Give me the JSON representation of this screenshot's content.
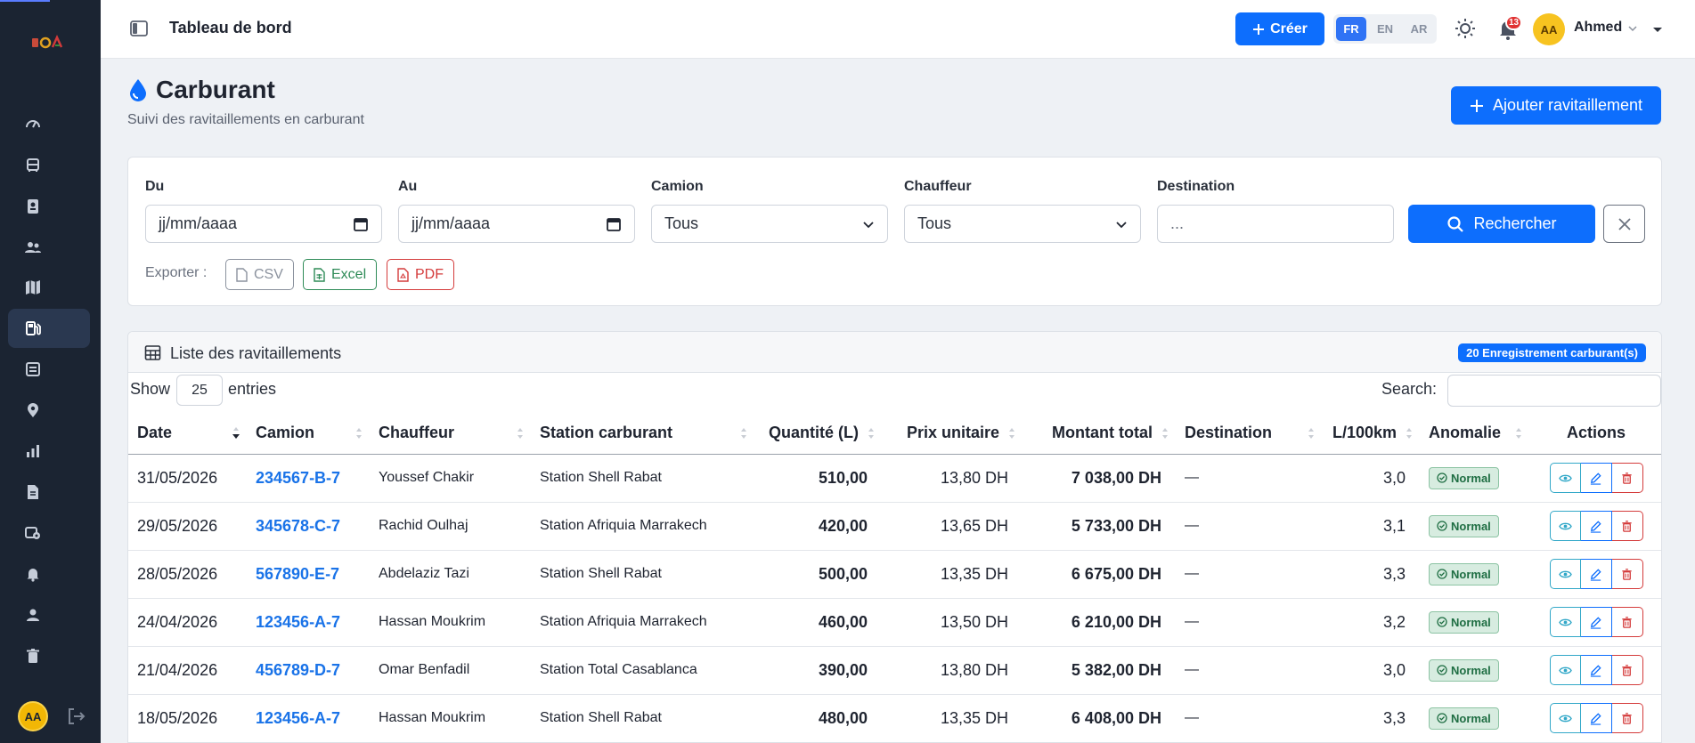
{
  "topbar": {
    "title": "Tableau de bord",
    "create_label": "Créer",
    "languages": [
      "FR",
      "EN",
      "AR"
    ],
    "active_language": "FR",
    "notification_count": "13",
    "user_initials": "AA",
    "user_name": "Ahmed"
  },
  "sidebar": {
    "items": [
      {
        "icon": "gauge-icon",
        "active": false
      },
      {
        "icon": "bus-icon",
        "active": false
      },
      {
        "icon": "id-card-icon",
        "active": false
      },
      {
        "icon": "users-icon",
        "active": false
      },
      {
        "icon": "map-icon",
        "active": false
      },
      {
        "icon": "fuel-pump-icon",
        "active": true
      },
      {
        "icon": "receipt-icon",
        "active": false
      },
      {
        "icon": "map-pin-icon",
        "active": false
      },
      {
        "icon": "bar-chart-icon",
        "active": false
      },
      {
        "icon": "document-icon",
        "active": false
      },
      {
        "icon": "settings-icon",
        "active": false
      },
      {
        "icon": "bell-icon",
        "active": false
      },
      {
        "icon": "user-icon",
        "active": false
      },
      {
        "icon": "trash-icon",
        "active": false
      }
    ],
    "user_initials": "AA"
  },
  "page": {
    "title": "Carburant",
    "subtitle": "Suivi des ravitaillements en carburant",
    "add_label": "Ajouter ravitaillement"
  },
  "filters": {
    "from_label": "Du",
    "from_placeholder": "jj/mm/aaaa",
    "to_label": "Au",
    "to_placeholder": "jj/mm/aaaa",
    "truck_label": "Camion",
    "truck_value": "Tous",
    "driver_label": "Chauffeur",
    "driver_value": "Tous",
    "destination_label": "Destination",
    "destination_placeholder": "...",
    "search_label": "Rechercher",
    "export_label": "Exporter :",
    "export_csv": "CSV",
    "export_excel": "Excel",
    "export_pdf": "PDF"
  },
  "table": {
    "card_title": "Liste des ravitaillements",
    "count_badge": "20 Enregistrement carburant(s)",
    "show_label": "Show",
    "show_value": "25",
    "entries_label": "entries",
    "search_label": "Search:",
    "columns": [
      "Date",
      "Camion",
      "Chauffeur",
      "Station carburant",
      "Quantité (L)",
      "Prix unitaire",
      "Montant total",
      "Destination",
      "L/100km",
      "Anomalie",
      "Actions"
    ],
    "rows": [
      {
        "date": "31/05/2026",
        "truck": "234567-B-7",
        "driver": "Youssef Chakir",
        "station": "Station Shell Rabat",
        "qty": "510,00",
        "price": "13,80 DH",
        "total": "7 038,00 DH",
        "dest": "—",
        "l100": "3,0",
        "anomaly": "Normal"
      },
      {
        "date": "29/05/2026",
        "truck": "345678-C-7",
        "driver": "Rachid Oulhaj",
        "station": "Station Afriquia Marrakech",
        "qty": "420,00",
        "price": "13,65 DH",
        "total": "5 733,00 DH",
        "dest": "—",
        "l100": "3,1",
        "anomaly": "Normal"
      },
      {
        "date": "28/05/2026",
        "truck": "567890-E-7",
        "driver": "Abdelaziz Tazi",
        "station": "Station Shell Rabat",
        "qty": "500,00",
        "price": "13,35 DH",
        "total": "6 675,00 DH",
        "dest": "—",
        "l100": "3,3",
        "anomaly": "Normal"
      },
      {
        "date": "24/04/2026",
        "truck": "123456-A-7",
        "driver": "Hassan Moukrim",
        "station": "Station Afriquia Marrakech",
        "qty": "460,00",
        "price": "13,50 DH",
        "total": "6 210,00 DH",
        "dest": "—",
        "l100": "3,2",
        "anomaly": "Normal"
      },
      {
        "date": "21/04/2026",
        "truck": "456789-D-7",
        "driver": "Omar Benfadil",
        "station": "Station Total Casablanca",
        "qty": "390,00",
        "price": "13,80 DH",
        "total": "5 382,00 DH",
        "dest": "—",
        "l100": "3,0",
        "anomaly": "Normal"
      },
      {
        "date": "18/05/2026",
        "truck": "123456-A-7",
        "driver": "Hassan Moukrim",
        "station": "Station Shell Rabat",
        "qty": "480,00",
        "price": "13,35 DH",
        "total": "6 408,00 DH",
        "dest": "—",
        "l100": "3,3",
        "anomaly": "Normal"
      }
    ]
  }
}
